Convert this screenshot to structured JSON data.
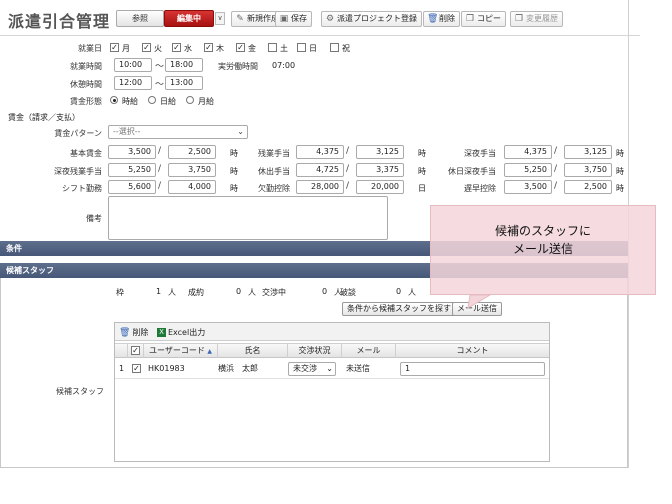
{
  "header": {
    "title": "派遣引合管理",
    "mode_ref": "参照",
    "mode_edit": "編集中",
    "mode_caret": "∨",
    "toolbar": [
      {
        "label": "新規作成",
        "icon": "new-doc-icon",
        "glyph": "✎",
        "disabled": false
      },
      {
        "label": "保存",
        "icon": "save-icon",
        "glyph": "▣",
        "disabled": false
      },
      {
        "label": "派遣プロジェクト登録",
        "icon": "project-register-icon",
        "glyph": "⚙",
        "disabled": false
      },
      {
        "label": "削除",
        "icon": "trash-icon",
        "glyph": "🗑",
        "disabled": false
      },
      {
        "label": "コピー",
        "icon": "copy-icon",
        "glyph": "❐",
        "disabled": false
      },
      {
        "label": "変更履歴",
        "icon": "history-icon",
        "glyph": "❐",
        "disabled": true
      }
    ]
  },
  "workdays": {
    "label": "就業日",
    "days": [
      {
        "label": "月",
        "checked": true
      },
      {
        "label": "火",
        "checked": true
      },
      {
        "label": "水",
        "checked": true
      },
      {
        "label": "木",
        "checked": true
      },
      {
        "label": "金",
        "checked": true
      },
      {
        "label": "土",
        "checked": false
      },
      {
        "label": "日",
        "checked": false
      },
      {
        "label": "祝",
        "checked": false
      }
    ]
  },
  "work_time": {
    "label": "就業時間",
    "start": "10:00",
    "end": "18:00",
    "tilde": "〜",
    "actual_label": "実労働時間",
    "actual_value": "07:00"
  },
  "break_time": {
    "label": "休憩時間",
    "start": "12:00",
    "end": "13:00",
    "tilde": "〜"
  },
  "wage_type": {
    "label": "賃金形態",
    "options": [
      {
        "label": "時給",
        "selected": true
      },
      {
        "label": "日給",
        "selected": false
      },
      {
        "label": "月給",
        "selected": false
      }
    ]
  },
  "wage_section": {
    "title": "賃金（請求／支払）"
  },
  "wage_pattern": {
    "label": "賃金パターン",
    "selected": "--選択--"
  },
  "rates": {
    "slash": "/",
    "rows": [
      [
        {
          "label": "基本賃金",
          "a": "3,500",
          "b": "2,500",
          "unit": "時"
        },
        {
          "label": "残業手当",
          "a": "4,375",
          "b": "3,125",
          "unit": "時"
        },
        {
          "label": "深夜手当",
          "a": "4,375",
          "b": "3,125",
          "unit": "時"
        }
      ],
      [
        {
          "label": "深夜残業手当",
          "a": "5,250",
          "b": "3,750",
          "unit": "時"
        },
        {
          "label": "休出手当",
          "a": "4,725",
          "b": "3,375",
          "unit": "時"
        },
        {
          "label": "休日深夜手当",
          "a": "5,250",
          "b": "3,750",
          "unit": "時"
        }
      ],
      [
        {
          "label": "シフト勤務",
          "a": "5,600",
          "b": "4,000",
          "unit": "時"
        },
        {
          "label": "欠勤控除",
          "a": "28,000",
          "b": "20,000",
          "unit": "日"
        },
        {
          "label": "遅早控除",
          "a": "3,500",
          "b": "2,500",
          "unit": "時"
        }
      ]
    ]
  },
  "remarks": {
    "label": "備考",
    "value": ""
  },
  "bars": {
    "conditions": "条件",
    "candidate_staff": "候補スタッフ"
  },
  "counts": [
    {
      "label": "枠",
      "value": "1",
      "unit": "人"
    },
    {
      "label": "成約",
      "value": "0",
      "unit": "人"
    },
    {
      "label": "交渉中",
      "value": "0",
      "unit": "人"
    },
    {
      "label": "破談",
      "value": "0",
      "unit": "人"
    }
  ],
  "actions": {
    "search_staff": "条件から候補スタッフを探す",
    "send_mail": "メール送信"
  },
  "staff_label": "候補スタッフ",
  "grid": {
    "toolbar": {
      "delete": "削除",
      "excel": "Excel出力"
    },
    "headers": {
      "user_code": "ユーザーコード",
      "name": "氏名",
      "status": "交渉状況",
      "mail": "メール",
      "comment": "コメント"
    },
    "sort_mark": "▲",
    "rows": [
      {
        "index": "1",
        "checked": true,
        "user_code": "HK01983",
        "name": "横浜　太郎",
        "status": "未交渉",
        "mail": "未送信",
        "comment": "1"
      }
    ]
  },
  "callout": {
    "line1": "候補のスタッフに",
    "line2": "メール送信"
  },
  "colors": {
    "edit_tab": "#c41f1f",
    "section_bar": "#4e5f80",
    "callout": "#f4d6da"
  }
}
